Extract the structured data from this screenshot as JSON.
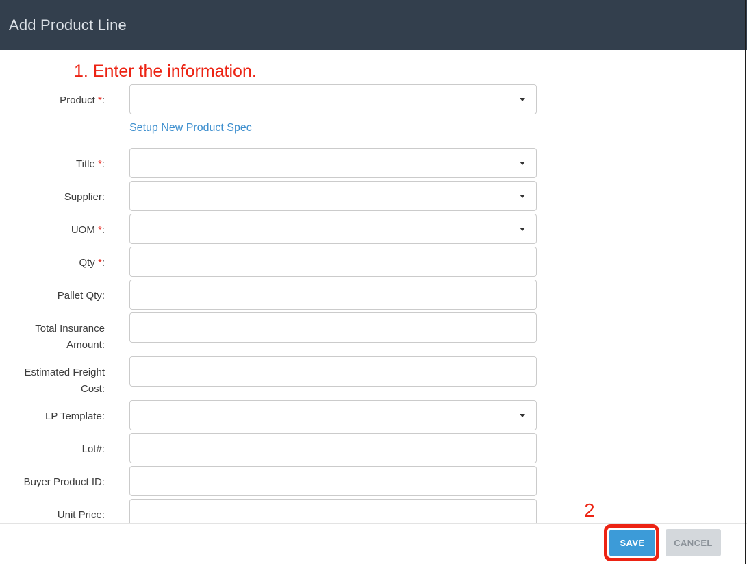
{
  "modal": {
    "title": "Add Product Line",
    "annotations": {
      "step1": "1. Enter the information.",
      "step2": "2"
    },
    "form": {
      "fields": [
        {
          "name": "product",
          "label": "Product",
          "required": true,
          "type": "select",
          "value": "",
          "link": "Setup New Product Spec"
        },
        {
          "name": "title",
          "label": "Title",
          "required": true,
          "type": "select",
          "value": ""
        },
        {
          "name": "supplier",
          "label": "Supplier",
          "required": false,
          "type": "select",
          "value": ""
        },
        {
          "name": "uom",
          "label": "UOM",
          "required": true,
          "type": "select",
          "value": ""
        },
        {
          "name": "qty",
          "label": "Qty",
          "required": true,
          "type": "text",
          "value": ""
        },
        {
          "name": "pallet-qty",
          "label": "Pallet Qty",
          "required": false,
          "type": "text",
          "value": ""
        },
        {
          "name": "total-insurance-amount",
          "label": "Total Insurance Amount",
          "required": false,
          "type": "text",
          "value": ""
        },
        {
          "name": "estimated-freight-cost",
          "label": "Estimated Freight Cost",
          "required": false,
          "type": "text",
          "value": ""
        },
        {
          "name": "lp-template",
          "label": "LP Template",
          "required": false,
          "type": "select",
          "value": ""
        },
        {
          "name": "lot-number",
          "label": "Lot#",
          "required": false,
          "type": "text",
          "value": ""
        },
        {
          "name": "buyer-product-id",
          "label": "Buyer Product ID",
          "required": false,
          "type": "text",
          "value": ""
        },
        {
          "name": "unit-price",
          "label": "Unit Price",
          "required": false,
          "type": "text",
          "value": ""
        }
      ]
    },
    "footer": {
      "save_label": "SAVE",
      "cancel_label": "CANCEL"
    }
  },
  "colors": {
    "header_bg": "#333f4d",
    "header_text": "#dde2e8",
    "annotation_red": "#ec2313",
    "required_red": "#e8261d",
    "link_blue": "#3e8fce",
    "input_border": "#cbcbcb",
    "save_bg": "#3c9bd8",
    "cancel_bg": "#d4d8dc",
    "cancel_text": "#8b9299"
  }
}
